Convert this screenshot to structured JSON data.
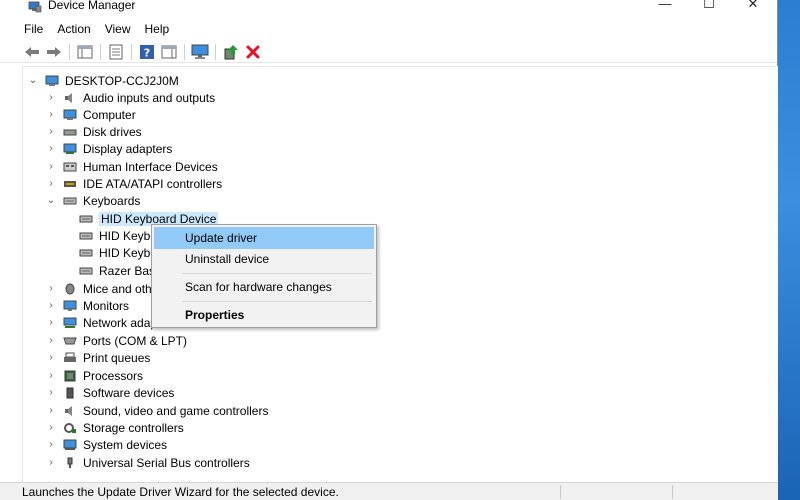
{
  "window": {
    "title": "Device Manager"
  },
  "window_controls": {
    "minimize": "—",
    "maximize": "☐",
    "close": "✕"
  },
  "menu": [
    "File",
    "Action",
    "View",
    "Help"
  ],
  "toolbar": [
    "back-icon",
    "forward-icon",
    "properties-pane-icon",
    "list-icon",
    "help-icon",
    "action-pane-icon",
    "monitor-icon",
    "update-driver-icon",
    "uninstall-icon"
  ],
  "tree": {
    "root": "DESKTOP-CCJ2J0M",
    "categories": [
      "Audio inputs and outputs",
      "Computer",
      "Disk drives",
      "Display adapters",
      "Human Interface Devices",
      "IDE ATA/ATAPI controllers",
      "Keyboards",
      "Mice and oth",
      "Monitors",
      "Network adap",
      "Ports (COM & LPT)",
      "Print queues",
      "Processors",
      "Software devices",
      "Sound, video and game controllers",
      "Storage controllers",
      "System devices",
      "Universal Serial Bus controllers"
    ],
    "keyboard_devices": [
      "HID Keyboard Device",
      "HID Keybo",
      "HID Keybo",
      "Razer Basi"
    ]
  },
  "context_menu": {
    "items": [
      "Update driver",
      "Uninstall device",
      "Scan for hardware changes",
      "Properties"
    ]
  },
  "status": {
    "text": "Launches the Update Driver Wizard for the selected device."
  },
  "colors": {
    "selection": "#cce8ff",
    "menu_highlight": "#91c9f7",
    "delete": "#e81123"
  }
}
